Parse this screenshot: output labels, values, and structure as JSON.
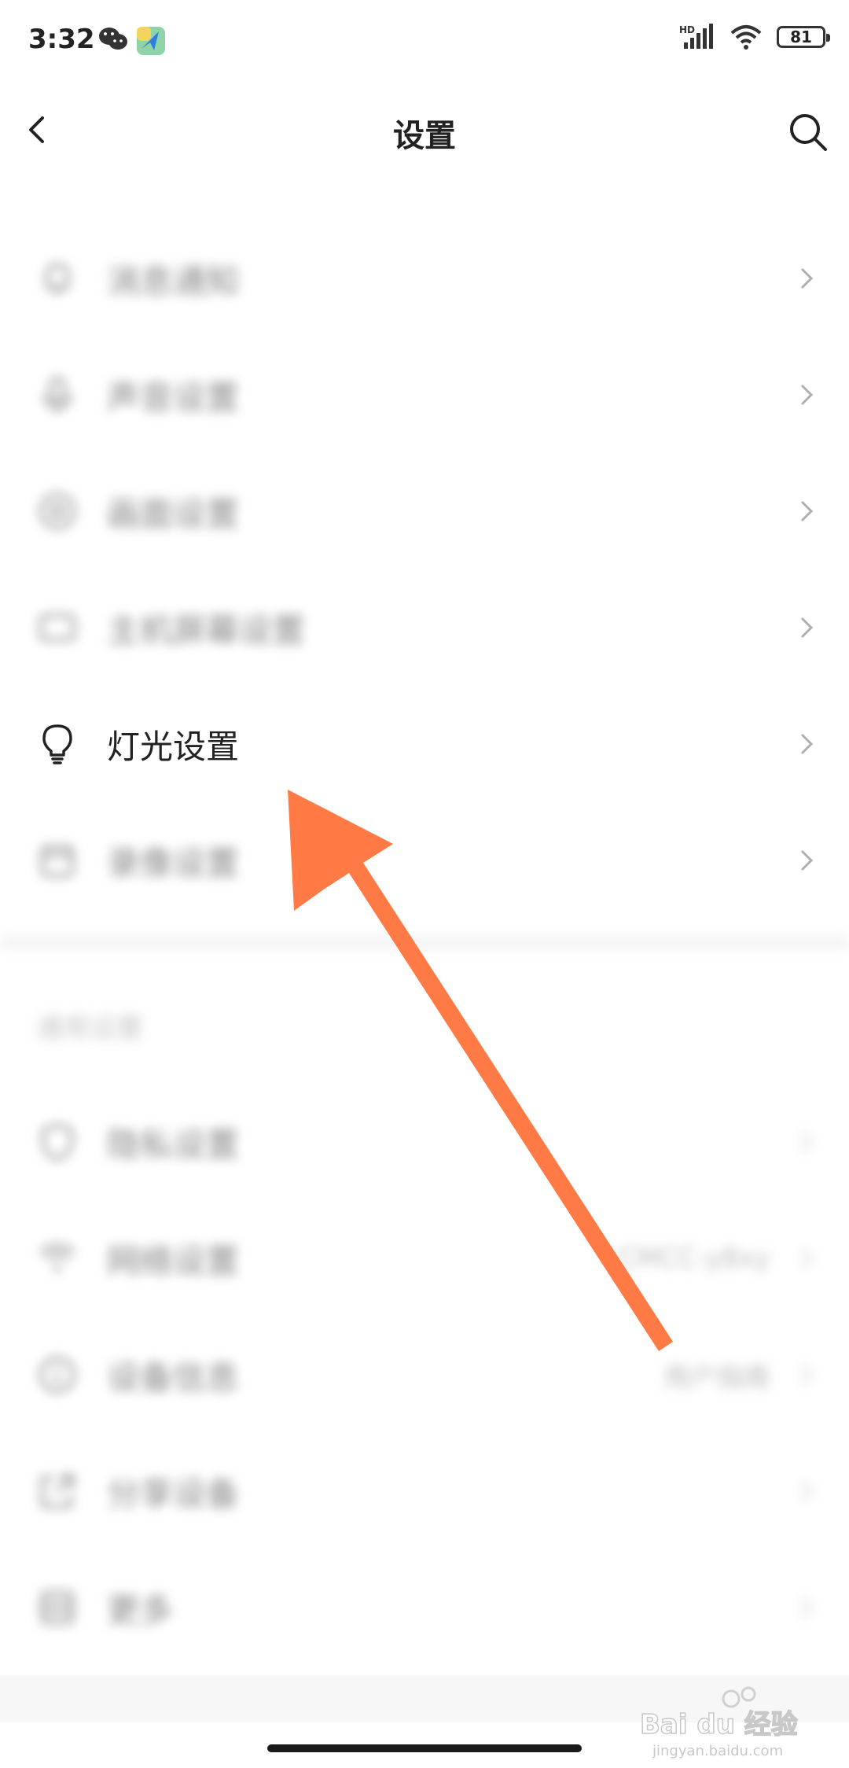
{
  "status_bar": {
    "time": "3:32",
    "network": "HD",
    "battery": "81"
  },
  "header": {
    "title": "设置",
    "back_icon": "chevron-left-icon",
    "search_icon": "search-icon"
  },
  "group1": {
    "items": [
      {
        "label": "消息通知",
        "icon": "bell-icon",
        "blurred": true
      },
      {
        "label": "声音设置",
        "icon": "microphone-icon",
        "blurred": true
      },
      {
        "label": "画面设置",
        "icon": "palette-icon",
        "blurred": true
      },
      {
        "label": "主机屏幕设置",
        "icon": "monitor-icon",
        "blurred": true
      },
      {
        "label": "灯光设置",
        "icon": "lightbulb-icon",
        "blurred": false
      },
      {
        "label": "录像设置",
        "icon": "record-icon",
        "blurred": true
      }
    ]
  },
  "section2": {
    "title": "通用设置"
  },
  "group2": {
    "items": [
      {
        "label": "隐私设置",
        "icon": "shield-icon",
        "right_text": ""
      },
      {
        "label": "网络设置",
        "icon": "wifi-icon",
        "right_text": "CMCC-y8xy"
      },
      {
        "label": "设备信息",
        "icon": "info-icon",
        "right_text": "用户指南"
      },
      {
        "label": "分享设备",
        "icon": "share-icon",
        "right_text": ""
      },
      {
        "label": "更多",
        "icon": "grid-icon",
        "right_text": ""
      }
    ]
  },
  "watermark": {
    "text": "Bai du 经验",
    "sub": "jingyan.baidu.com"
  },
  "colors": {
    "arrow": "#ff7a45",
    "text": "#222222",
    "chevron": "#b0b0b0"
  }
}
